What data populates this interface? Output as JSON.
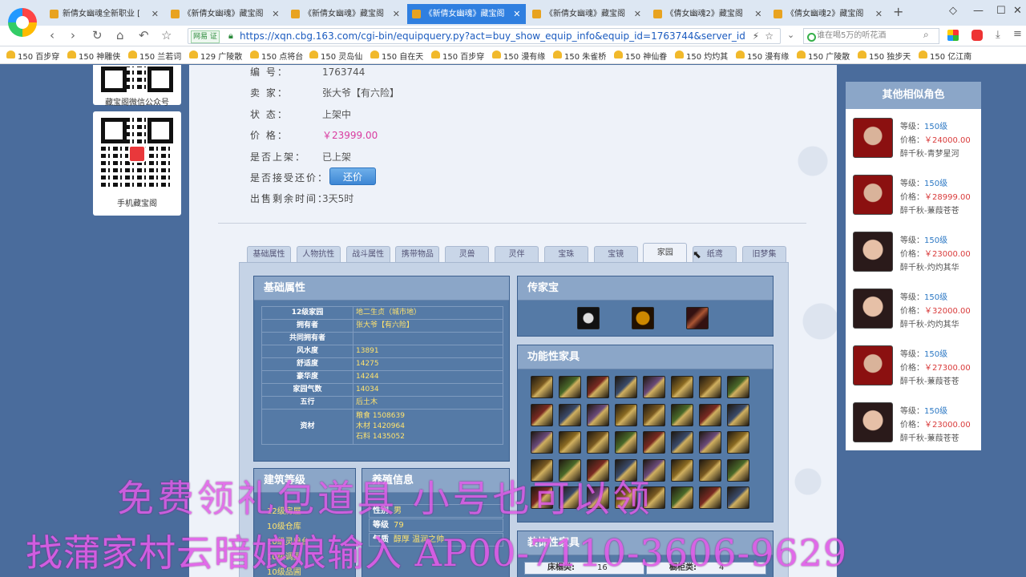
{
  "browser": {
    "tabs": [
      {
        "label": "新倩女幽魂全新职业 [",
        "active": false
      },
      {
        "label": "《新倩女幽魂》藏宝阁",
        "active": false
      },
      {
        "label": "《新倩女幽魂》藏宝阁",
        "active": false
      },
      {
        "label": "《新倩女幽魂》藏宝阁",
        "active": true
      },
      {
        "label": "《新倩女幽魂》藏宝阁",
        "active": false
      },
      {
        "label": "《倩女幽魂2》藏宝阁",
        "active": false
      },
      {
        "label": "《倩女幽魂2》藏宝阁",
        "active": false
      }
    ],
    "url_badge": "网易 证",
    "url": "https://xqn.cbg.163.com/cgi-bin/equipquery.py?act=buy_show_equip_info&equip_id=1763744&server_id",
    "search_placeholder": "谁在喝5万的听花酒",
    "bookmarks": [
      "150 百步穿",
      "150 神雕侠",
      "150 兰若词",
      "129 广陵散",
      "150 点将台",
      "150 灵岛仙",
      "150 自在天",
      "150 百步穿",
      "150 漫有缘",
      "150 朱雀桥",
      "150 神仙眷",
      "150 灼灼其",
      "150 漫有缘",
      "150 广陵散",
      "150 独步天",
      "150 亿江南"
    ]
  },
  "qr": {
    "wechat_caption": "藏宝阁微信公众号",
    "mobile_caption": "手机藏宝阁"
  },
  "info": [
    {
      "label": "编  号：",
      "value": "1763744",
      "style": ""
    },
    {
      "label": "卖  家：",
      "value": "张大爷【有六险】",
      "style": ""
    },
    {
      "label": "状  态：",
      "value": "上架中",
      "style": ""
    },
    {
      "label": "价  格：",
      "value": "￥23999.00",
      "style": "price"
    },
    {
      "label": "是否上架：",
      "value": "已上架",
      "style": ""
    },
    {
      "label": "是否接受还价：",
      "value": "",
      "style": ""
    },
    {
      "label": "出售剩余时间：",
      "value": "3天5时",
      "style": ""
    }
  ],
  "bargain_label": "还价",
  "tabs": [
    "基础属性",
    "人物抗性",
    "战斗属性",
    "携带物品",
    "灵兽",
    "灵伴",
    "宝珠",
    "宝镜",
    "家园",
    "纸鸢",
    "旧梦集"
  ],
  "active_tab": 8,
  "home": {
    "basic_title": "基础属性",
    "basic_rows": [
      {
        "k": "12级家园",
        "v": "地二生贞（城市地）"
      },
      {
        "k": "拥有者",
        "v": "张大爷【有六险】"
      },
      {
        "k": "共同拥有者",
        "v": ""
      },
      {
        "k": "风水度",
        "v": "13891"
      },
      {
        "k": "舒适度",
        "v": "14275"
      },
      {
        "k": "豪华度",
        "v": "14244"
      },
      {
        "k": "家园气数",
        "v": "14034"
      },
      {
        "k": "五行",
        "v": "后土木"
      }
    ],
    "resources_label": "资材",
    "resources": [
      "粮食 1508639",
      "木材 1420964",
      "石料 1435052"
    ],
    "heirloom_title": "传家宝",
    "func_title": "功能性家具",
    "building_title": "建筑等级",
    "buildings": [
      "12级房屋",
      "10级仓库",
      "10级灵兽台",
      "10级调圃",
      "10级品圃"
    ],
    "raise_title": "养殖信息",
    "raise_rows": [
      {
        "k": "性别",
        "v": "男"
      },
      {
        "k": "等级",
        "v": "79"
      },
      {
        "k": "气质",
        "v": "醇厚 温润之帅"
      }
    ],
    "decor_title": "装饰性家具",
    "decor_rows": [
      {
        "k": "床榻类:",
        "v": "16"
      },
      {
        "k": "橱柜类:",
        "v": "4"
      }
    ]
  },
  "overlay": {
    "line1": "免费领礼包道具 小号也可以领",
    "line2": "找蒲家村云暗娘娘输入 AP00-7110-3606-9629"
  },
  "similar": {
    "title": "其他相似角色",
    "items": [
      {
        "level": "150级",
        "price": "￥24000.00",
        "server": "醉千秋-青梦星河",
        "avatar": "red"
      },
      {
        "level": "150级",
        "price": "￥28999.00",
        "server": "醉千秋-蒹葭苍苍",
        "avatar": "red"
      },
      {
        "level": "150级",
        "price": "￥23000.00",
        "server": "醉千秋-灼灼其华",
        "avatar": "dark"
      },
      {
        "level": "150级",
        "price": "￥32000.00",
        "server": "醉千秋-灼灼其华",
        "avatar": "dark"
      },
      {
        "level": "150级",
        "price": "￥27300.00",
        "server": "醉千秋-蒹葭苍苍",
        "avatar": "red"
      },
      {
        "level": "150级",
        "price": "￥23000.00",
        "server": "醉千秋-蒹葭苍苍",
        "avatar": "dark"
      }
    ],
    "level_label": "等级：",
    "price_label": "价格："
  }
}
